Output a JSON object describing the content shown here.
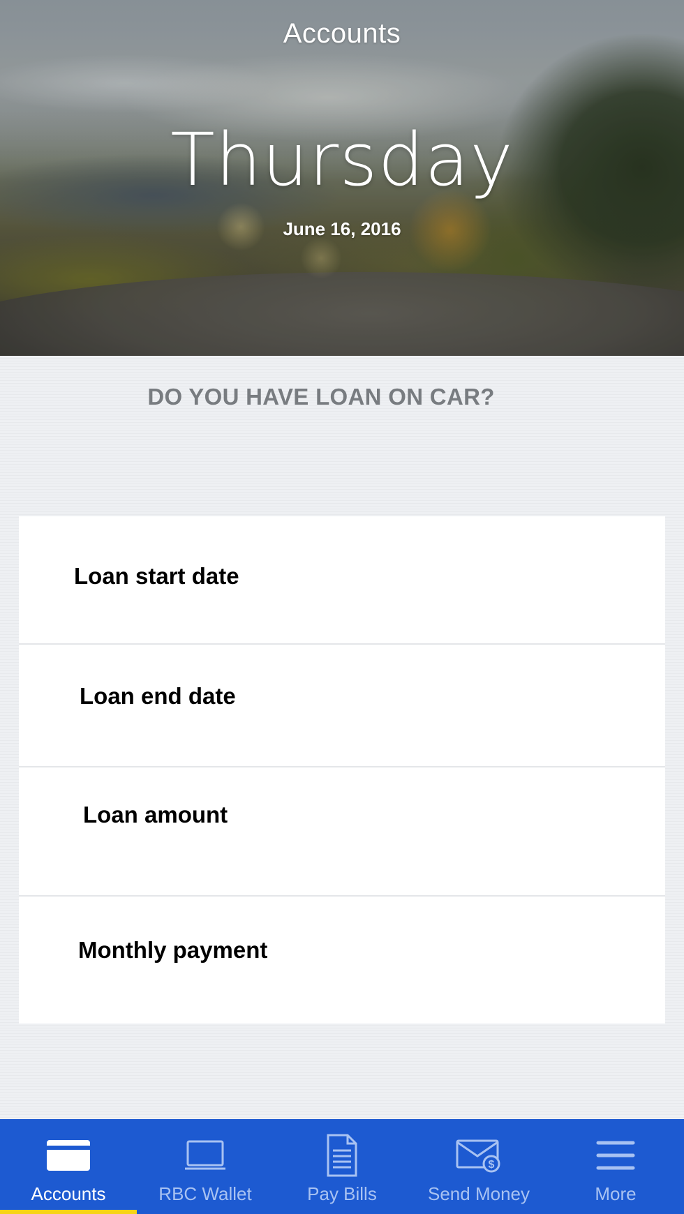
{
  "header": {
    "title": "Accounts",
    "day": "Thursday",
    "date": "June 16, 2016"
  },
  "main": {
    "question": "DO YOU HAVE LOAN ON CAR?",
    "fields": [
      {
        "label": "Loan start date"
      },
      {
        "label": "Loan end date"
      },
      {
        "label": "Loan amount"
      },
      {
        "label": "Monthly payment"
      }
    ]
  },
  "tabbar": {
    "active_tab": "Accounts",
    "active_indicator_color": "#f7d417",
    "background_color": "#1d5ad1",
    "tabs": [
      {
        "label": "Accounts",
        "icon": "card-icon"
      },
      {
        "label": "RBC Wallet",
        "icon": "laptop-icon"
      },
      {
        "label": "Pay Bills",
        "icon": "document-icon"
      },
      {
        "label": "Send Money",
        "icon": "envelope-dollar-icon"
      },
      {
        "label": "More",
        "icon": "hamburger-menu-icon"
      }
    ]
  }
}
